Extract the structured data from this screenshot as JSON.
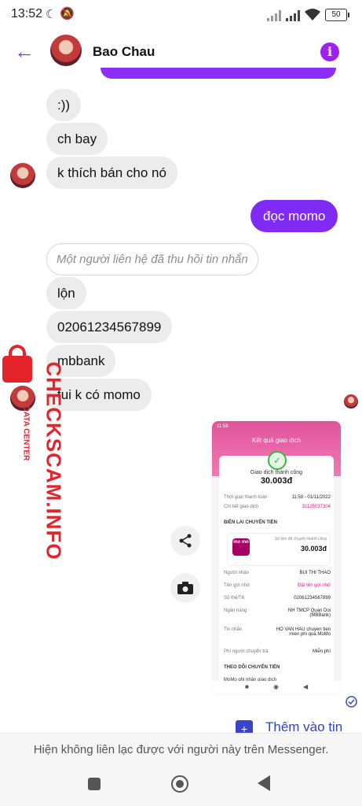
{
  "status_bar": {
    "time": "13:52",
    "battery": "50"
  },
  "header": {
    "contact_name": "Bao Chau"
  },
  "messages": {
    "m1": ":))",
    "m2": "ch bay",
    "m3": "k thích bán cho nó",
    "m4": "đọc momo",
    "m5": "Một người liên hệ đã thu hồi tin nhắn",
    "m6": "lộn",
    "m7": "02061234567899",
    "m8": "mbbank",
    "m9": "tui k có momo"
  },
  "receipt": {
    "status_time": "11:58",
    "title": "Kết quả giao dịch",
    "result_label": "Giao dịch thành công",
    "amount": "30.003đ",
    "time_label": "Thời gian thanh toán",
    "time_value": "11:58 - 01/11/2022",
    "detail_label": "Chi tiết giao dịch",
    "detail_value": "31125037304",
    "receipt_section": "BIÊN LAI CHUYỂN TIỀN",
    "momo_logo": "mo mo",
    "sent_label": "Số tiền đã chuyển thành công",
    "sent_value": "30.003đ",
    "recipient_label": "Người nhận",
    "recipient_value": "BUI THI THAO",
    "nickname_label": "Tên gợi nhớ",
    "nickname_value": "Đặt tên gợi nhớ",
    "account_label": "Số thẻ/TK",
    "account_value": "02061234567899",
    "bank_label": "Ngân hàng",
    "bank_value": "NH TMCP Quan Doi (MBBank)",
    "message_label": "Tin nhắn",
    "message_value": "HO VAN HAU chuyen tien mien phi qua MoMo",
    "fee_label": "Phí người chuyển trả",
    "fee_value": "Miễn phí",
    "track_section": "THEO DÕI CHUYỂN TIỀN",
    "track_item": "MoMo ghi nhận giao dịch"
  },
  "actions": {
    "add_to_story": "Thêm vào tin"
  },
  "footer": {
    "unavailable_notice": "Hiện không liên lạc được với người này trên Messenger."
  },
  "watermark": {
    "main": "CHECKSCAM.INFO",
    "sub": "DATA CENTER"
  },
  "colors": {
    "accent": "#7f2bf5",
    "incoming_bubble": "#ececec",
    "momo": "#a50064"
  }
}
